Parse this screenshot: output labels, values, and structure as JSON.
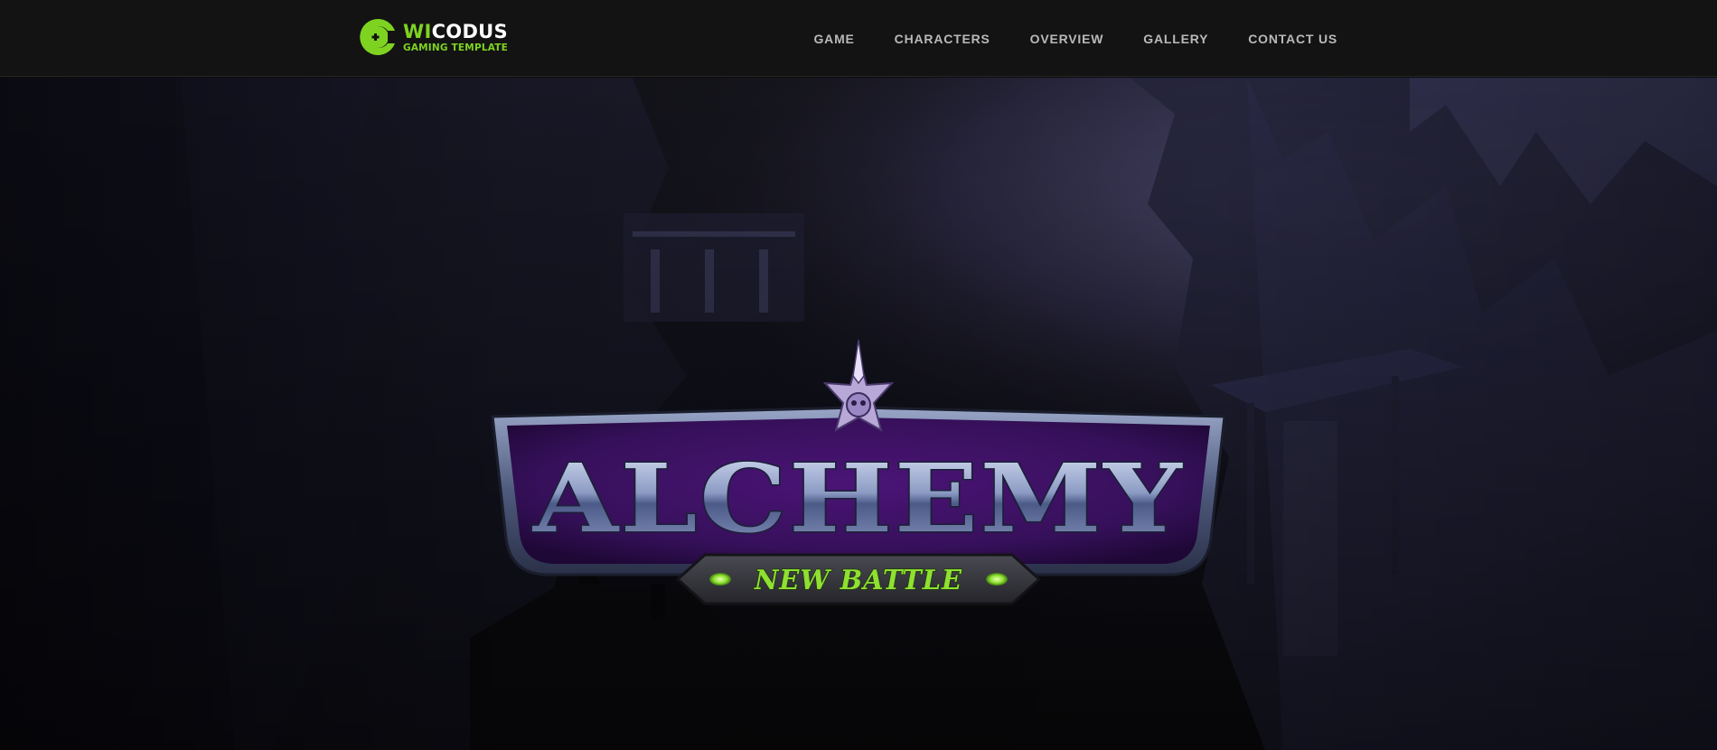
{
  "brand": {
    "name_accent": "WI",
    "name_rest": "CODUS",
    "tagline": "GAMING TEMPLATE",
    "logo_icon": "gamepad-c-icon",
    "accent_color": "#7ed321"
  },
  "nav": {
    "items": [
      {
        "label": "GAME"
      },
      {
        "label": "CHARACTERS"
      },
      {
        "label": "OVERVIEW"
      },
      {
        "label": "GALLERY"
      },
      {
        "label": "CONTACT US"
      }
    ]
  },
  "hero": {
    "background": "dark-fantasy-cliff-city",
    "title": "ALCHEMY",
    "subtitle": "NEW BATTLE",
    "emblem_icon": "crystal-skull-crest-icon",
    "colors": {
      "banner": "#3b0f63",
      "subtitle_text": "#8fe032"
    }
  }
}
